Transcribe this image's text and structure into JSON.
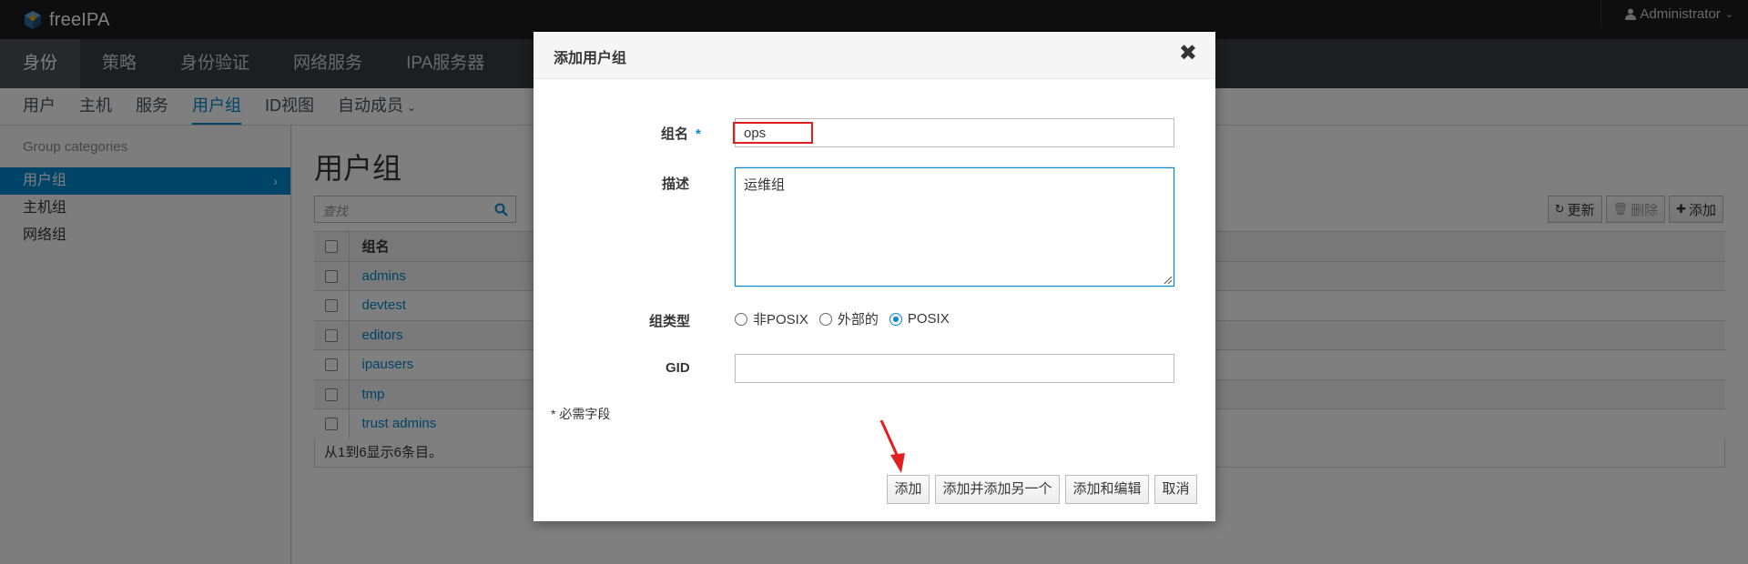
{
  "app": {
    "name": "freeIPA"
  },
  "user_menu": {
    "label": "Administrator",
    "icon": "user-icon"
  },
  "primary_nav": [
    {
      "label": "身份",
      "active": true
    },
    {
      "label": "策略"
    },
    {
      "label": "身份验证"
    },
    {
      "label": "网络服务"
    },
    {
      "label": "IPA服务器"
    }
  ],
  "secondary_nav": [
    {
      "label": "用户"
    },
    {
      "label": "主机"
    },
    {
      "label": "服务"
    },
    {
      "label": "用户组",
      "active": true
    },
    {
      "label": "ID视图"
    },
    {
      "label": "自动成员"
    }
  ],
  "sidebar": {
    "heading": "Group categories",
    "items": [
      {
        "label": "用户组",
        "active": true
      },
      {
        "label": "主机组"
      },
      {
        "label": "网络组"
      }
    ]
  },
  "main": {
    "title": "用户组",
    "search_placeholder": "查找",
    "actions": {
      "refresh": "更新",
      "delete": "删除",
      "add": "添加"
    },
    "table": {
      "column": "组名",
      "rows": [
        "admins",
        "devtest",
        "editors",
        "ipausers",
        "tmp",
        "trust admins"
      ],
      "footer": "从1到6显示6条目。"
    }
  },
  "dialog": {
    "title": "添加用户组",
    "fields": {
      "name_label": "组名",
      "name_value": "ops",
      "required_mark": "*",
      "desc_label": "描述",
      "desc_value": "运维组",
      "type_label": "组类型",
      "type_options": [
        "非POSIX",
        "外部的",
        "POSIX"
      ],
      "type_selected": "POSIX",
      "gid_label": "GID",
      "gid_value": ""
    },
    "required_note": "* 必需字段",
    "buttons": {
      "add": "添加",
      "add_another": "添加并添加另一个",
      "add_edit": "添加和编辑",
      "cancel": "取消"
    }
  },
  "colors": {
    "accent": "#0088ce",
    "highlight": "#e02020"
  }
}
